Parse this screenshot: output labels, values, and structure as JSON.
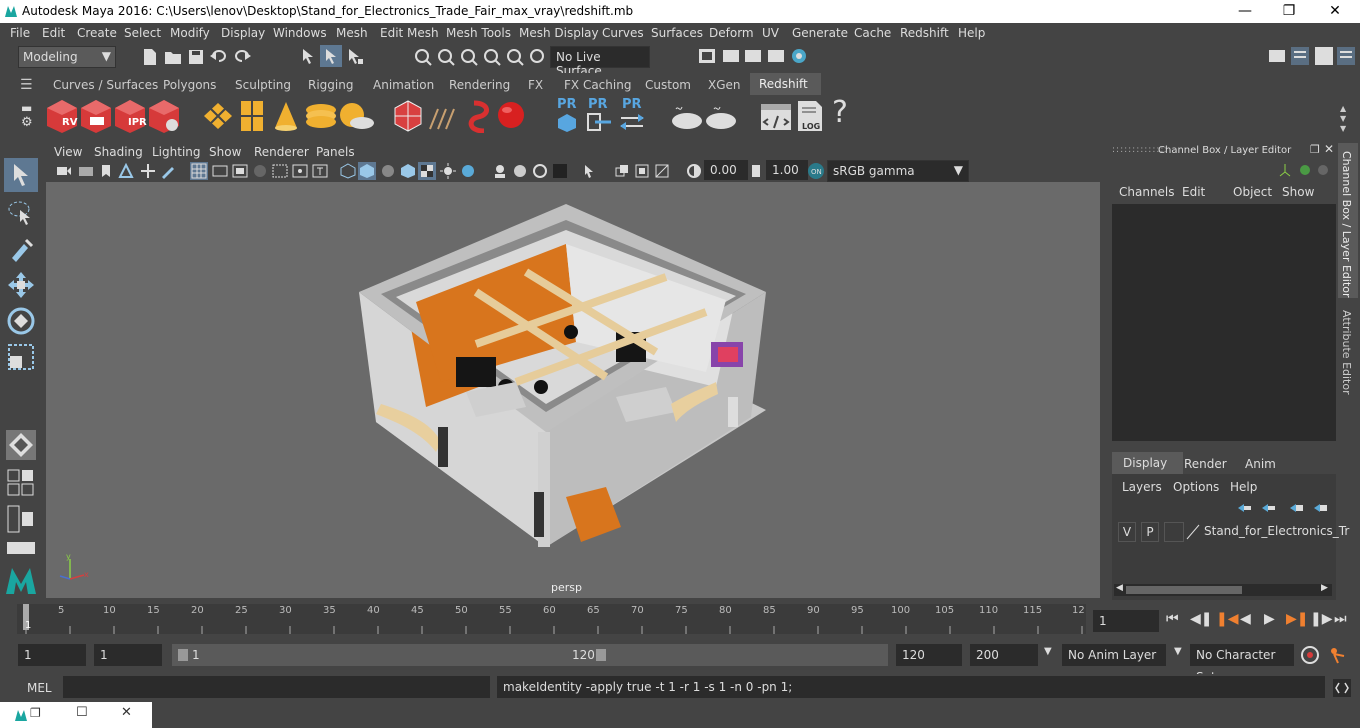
{
  "window": {
    "title": "Autodesk Maya 2016: C:\\Users\\lenov\\Desktop\\Stand_for_Electronics_Trade_Fair_max_vray\\redshift.mb"
  },
  "menu": [
    "File",
    "Edit",
    "Create",
    "Select",
    "Modify",
    "Display",
    "Windows",
    "Mesh",
    "Edit Mesh",
    "Mesh Tools",
    "Mesh Display",
    "Curves",
    "Surfaces",
    "Deform",
    "UV",
    "Generate",
    "Cache",
    "Redshift",
    "Help"
  ],
  "status": {
    "mode": "Modeling",
    "live_surface": "No Live Surface"
  },
  "shelf_tabs": [
    "Curves / Surfaces",
    "Polygons",
    "Sculpting",
    "Rigging",
    "Animation",
    "Rendering",
    "FX",
    "FX Caching",
    "Custom",
    "XGen",
    "Redshift"
  ],
  "shelf_icon_labels": {
    "rv": "RV",
    "ipr": "IPR",
    "pr1": "PR",
    "pr2": "PR",
    "pr3": "PR",
    "log": "LOG",
    "help": "?"
  },
  "panel_menu": [
    "View",
    "Shading",
    "Lighting",
    "Show",
    "Renderer",
    "Panels"
  ],
  "panel_tools": {
    "exposure": "0.00",
    "gamma": "1.00",
    "colorspace": "sRGB gamma"
  },
  "viewport": {
    "camera": "persp"
  },
  "channel_box": {
    "title": "Channel Box / Layer Editor",
    "menu": [
      "Channels",
      "Edit",
      "Object",
      "Show"
    ]
  },
  "side_tabs": {
    "channel": "Channel Box / Layer Editor",
    "attr": "Attribute Editor"
  },
  "layer_editor": {
    "tabs": [
      "Display",
      "Render",
      "Anim"
    ],
    "menu": [
      "Layers",
      "Options",
      "Help"
    ],
    "layer": {
      "v": "V",
      "p": "P",
      "name": "Stand_for_Electronics_Tr"
    }
  },
  "timeline": {
    "ticks": [
      "5",
      "10",
      "15",
      "20",
      "25",
      "30",
      "35",
      "40",
      "45",
      "50",
      "55",
      "60",
      "65",
      "70",
      "75",
      "80",
      "85",
      "90",
      "95",
      "100",
      "105",
      "110",
      "115",
      "12"
    ],
    "start_marker": "1",
    "current_frame": "1"
  },
  "range": {
    "start": "1",
    "start2": "1",
    "slider_start": "1",
    "slider_end": "120",
    "end": "120",
    "max": "200",
    "anim_layer": "No Anim Layer",
    "char_set": "No Character Set"
  },
  "mel": {
    "label": "MEL",
    "output": "makeIdentity -apply true -t 1 -r 1 -s 1 -n 0 -pn 1;"
  },
  "colors": {
    "accent": "#4a5a6a",
    "redshift": "#d63a3a",
    "orange": "#d8751d",
    "blue": "#58a6e0"
  }
}
